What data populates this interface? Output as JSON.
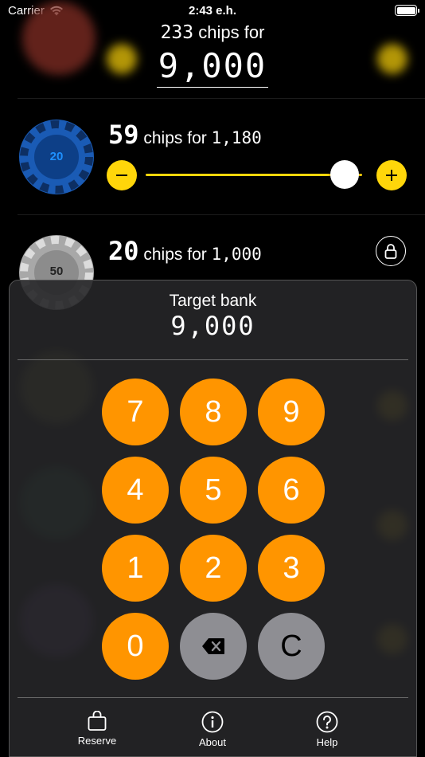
{
  "status_bar": {
    "carrier": "Carrier",
    "time": "2:43 e.h."
  },
  "header": {
    "count": "233",
    "chips_for": "chips for",
    "total": "9,000"
  },
  "rows": [
    {
      "count": "59",
      "chips_for": "chips for",
      "amount": "1,180",
      "denomination": "20",
      "color": "#1a5bb5",
      "slider_fraction": 0.92
    },
    {
      "count": "20",
      "chips_for": "chips for",
      "amount": "1,000",
      "denomination": "50",
      "color": "#9a9a9a",
      "locked": true
    }
  ],
  "keypad": {
    "title": "Target bank",
    "value": "9,000",
    "keys": [
      "7",
      "8",
      "9",
      "4",
      "5",
      "6",
      "1",
      "2",
      "3",
      "0",
      "C"
    ]
  },
  "tabs": [
    {
      "label": "Reserve",
      "icon": "bag-icon"
    },
    {
      "label": "About",
      "icon": "info-icon"
    },
    {
      "label": "Help",
      "icon": "question-icon"
    }
  ],
  "colors": {
    "accent_yellow": "#ffd60a",
    "key_orange": "#ff9500",
    "key_gray": "#8e8e93"
  }
}
